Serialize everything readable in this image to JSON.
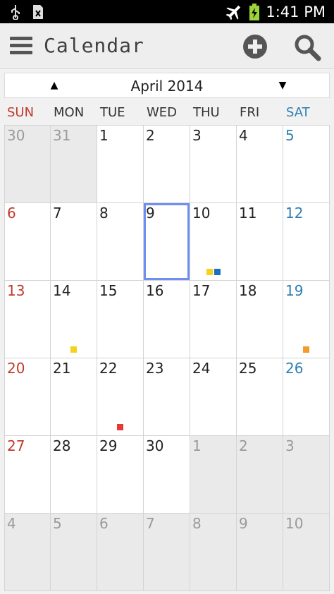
{
  "status_bar": {
    "time": "1:41 PM"
  },
  "action_bar": {
    "title": "Calendar"
  },
  "month_nav": {
    "title": "April 2014",
    "prev_glyph": "▲",
    "next_glyph": "▼"
  },
  "weekdays": [
    "SUN",
    "MON",
    "TUE",
    "WED",
    "THU",
    "FRI",
    "SAT"
  ],
  "colors": {
    "sunday": "#c0392b",
    "saturday": "#2d7fb0",
    "today_border": "#6e8ef0",
    "event_yellow": "#f5d31b",
    "event_blue": "#1f6fc0",
    "event_orange": "#f39a2c",
    "event_red": "#e53935"
  },
  "weeks": [
    [
      {
        "day": "30",
        "other": true
      },
      {
        "day": "31",
        "other": true
      },
      {
        "day": "1"
      },
      {
        "day": "2"
      },
      {
        "day": "3"
      },
      {
        "day": "4"
      },
      {
        "day": "5"
      }
    ],
    [
      {
        "day": "6"
      },
      {
        "day": "7"
      },
      {
        "day": "8"
      },
      {
        "day": "9",
        "today": true
      },
      {
        "day": "10",
        "events": [
          "#f5d31b",
          "#1f6fc0"
        ]
      },
      {
        "day": "11"
      },
      {
        "day": "12"
      }
    ],
    [
      {
        "day": "13"
      },
      {
        "day": "14",
        "events": [
          "#f5d31b"
        ]
      },
      {
        "day": "15"
      },
      {
        "day": "16"
      },
      {
        "day": "17"
      },
      {
        "day": "18"
      },
      {
        "day": "19",
        "events": [
          "#f39a2c"
        ]
      }
    ],
    [
      {
        "day": "20"
      },
      {
        "day": "21"
      },
      {
        "day": "22",
        "events": [
          "#e53935"
        ]
      },
      {
        "day": "23"
      },
      {
        "day": "24"
      },
      {
        "day": "25"
      },
      {
        "day": "26"
      }
    ],
    [
      {
        "day": "27"
      },
      {
        "day": "28"
      },
      {
        "day": "29"
      },
      {
        "day": "30"
      },
      {
        "day": "1",
        "other": true
      },
      {
        "day": "2",
        "other": true
      },
      {
        "day": "3",
        "other": true
      }
    ],
    [
      {
        "day": "4",
        "other": true
      },
      {
        "day": "5",
        "other": true
      },
      {
        "day": "6",
        "other": true
      },
      {
        "day": "7",
        "other": true
      },
      {
        "day": "8",
        "other": true
      },
      {
        "day": "9",
        "other": true
      },
      {
        "day": "10",
        "other": true
      }
    ]
  ]
}
